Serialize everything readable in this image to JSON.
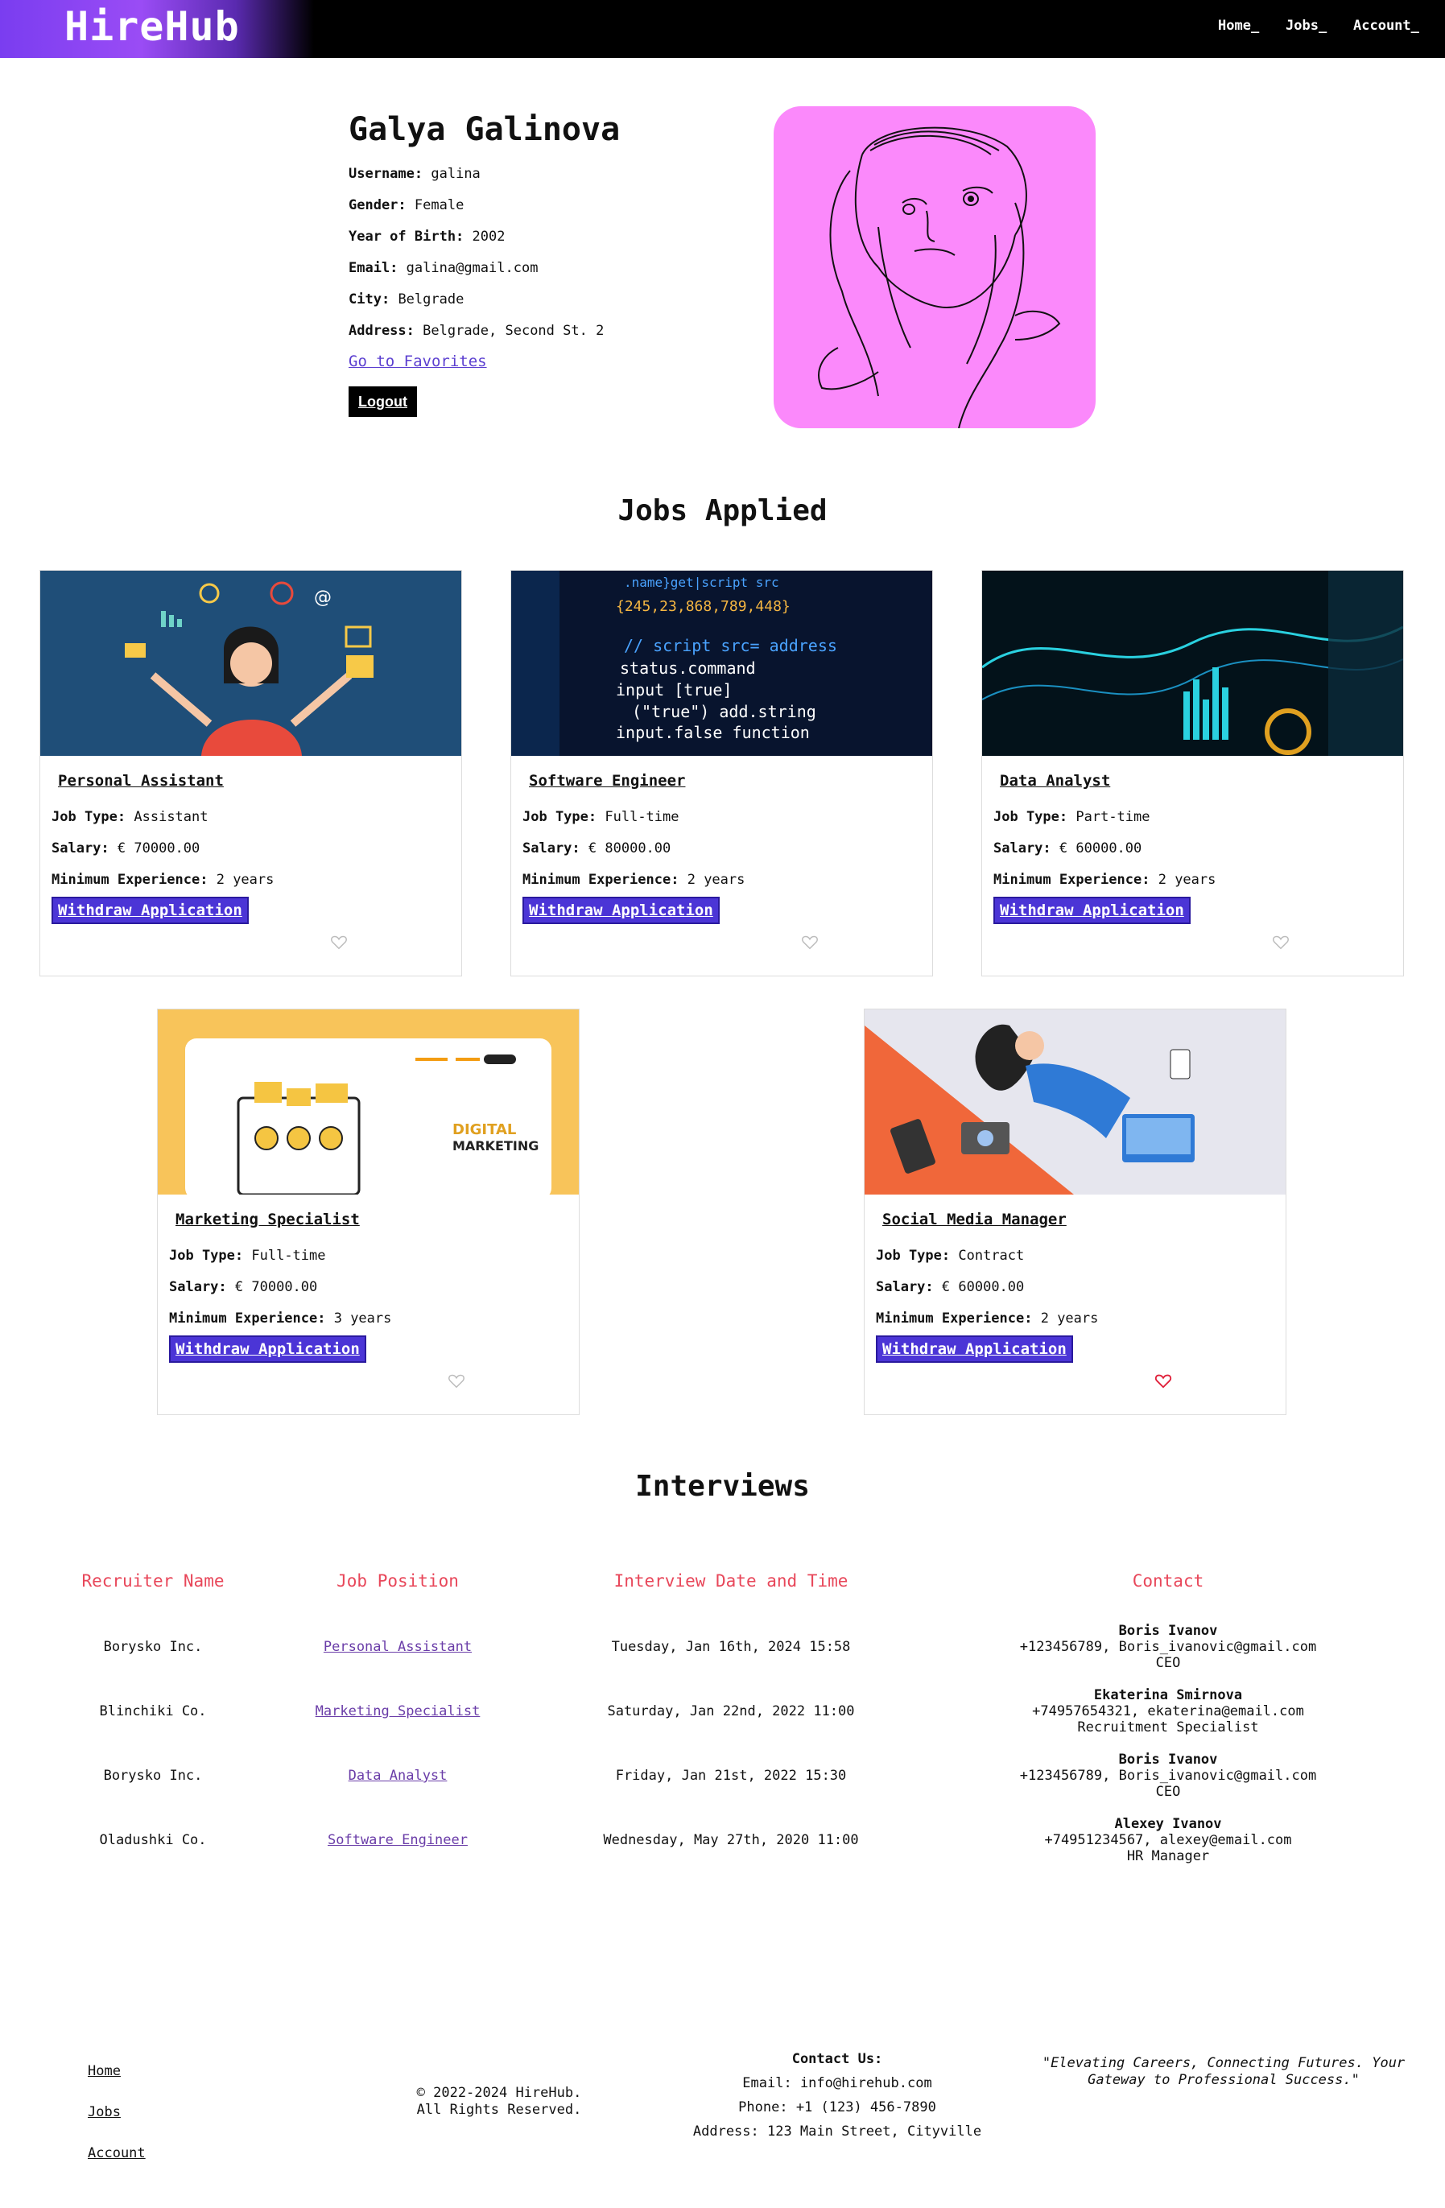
{
  "nav": {
    "logo": "HireHub",
    "links": [
      "Home_",
      "Jobs_",
      "Account_"
    ]
  },
  "profile": {
    "name": "Galya Galinova",
    "fields": [
      {
        "label": "Username:",
        "value": "galina"
      },
      {
        "label": "Gender:",
        "value": "Female"
      },
      {
        "label": "Year of Birth:",
        "value": "2002"
      },
      {
        "label": "Email:",
        "value": "galina@gmail.com"
      },
      {
        "label": "City:",
        "value": "Belgrade"
      },
      {
        "label": "Address:",
        "value": "Belgrade, Second St. 2"
      }
    ],
    "favorites_link": "Go to Favorites",
    "logout_label": "Logout"
  },
  "jobs_applied": {
    "title": "Jobs Applied",
    "labels": {
      "type": "Job Type:",
      "salary": "Salary:",
      "experience": "Minimum Experience:"
    },
    "withdraw_label": "Withdraw Application",
    "jobs": [
      {
        "title": "Personal Assistant",
        "type": "Assistant",
        "salary": "€ 70000.00",
        "experience": "2 years",
        "favorite": false
      },
      {
        "title": "Software Engineer",
        "type": "Full-time",
        "salary": "€ 80000.00",
        "experience": "2 years",
        "favorite": false
      },
      {
        "title": "Data Analyst",
        "type": "Part-time",
        "salary": "€ 60000.00",
        "experience": "2 years",
        "favorite": false
      },
      {
        "title": "Marketing Specialist",
        "type": "Full-time",
        "salary": "€ 70000.00",
        "experience": "3 years",
        "favorite": false
      },
      {
        "title": "Social Media Manager",
        "type": "Contract",
        "salary": "€ 60000.00",
        "experience": "2 years",
        "favorite": true
      }
    ]
  },
  "interviews": {
    "title": "Interviews",
    "headers": [
      "Recruiter Name",
      "Job Position",
      "Interview Date and Time",
      "Contact"
    ],
    "rows": [
      {
        "recruiter": "Borysko Inc.",
        "position": "Personal Assistant",
        "datetime": "Tuesday, Jan 16th, 2024 15:58",
        "contact_name": "Boris Ivanov",
        "contact_line": "+123456789, Boris_ivanovic@gmail.com",
        "contact_role": "CEO"
      },
      {
        "recruiter": "Blinchiki Co.",
        "position": "Marketing Specialist",
        "datetime": "Saturday, Jan 22nd, 2022 11:00",
        "contact_name": "Ekaterina Smirnova",
        "contact_line": "+74957654321, ekaterina@email.com",
        "contact_role": "Recruitment Specialist"
      },
      {
        "recruiter": "Borysko Inc.",
        "position": "Data Analyst",
        "datetime": "Friday, Jan 21st, 2022 15:30",
        "contact_name": "Boris Ivanov",
        "contact_line": "+123456789, Boris_ivanovic@gmail.com",
        "contact_role": "CEO"
      },
      {
        "recruiter": "Oladushki Co.",
        "position": "Software Engineer",
        "datetime": "Wednesday, May 27th, 2020 11:00",
        "contact_name": "Alexey Ivanov",
        "contact_line": "+74951234567, alexey@email.com",
        "contact_role": "HR Manager"
      }
    ]
  },
  "footer": {
    "links": [
      "Home",
      "Jobs",
      "Account"
    ],
    "copyright_line1": "© 2022-2024 HireHub.",
    "copyright_line2": "All Rights Reserved.",
    "contact_title": "Contact Us:",
    "email": "Email: info@hirehub.com",
    "phone": "Phone: +1 (123) 456-7890",
    "address": "Address: 123 Main Street, Cityville",
    "quote": "\"Elevating Careers, Connecting Futures. Your Gateway to Professional Success.\""
  },
  "colors": {
    "accent": "#4b35d6",
    "header_red": "#e8475a",
    "avatar_bg": "#fb89fb",
    "heart_red": "#e0203a"
  }
}
